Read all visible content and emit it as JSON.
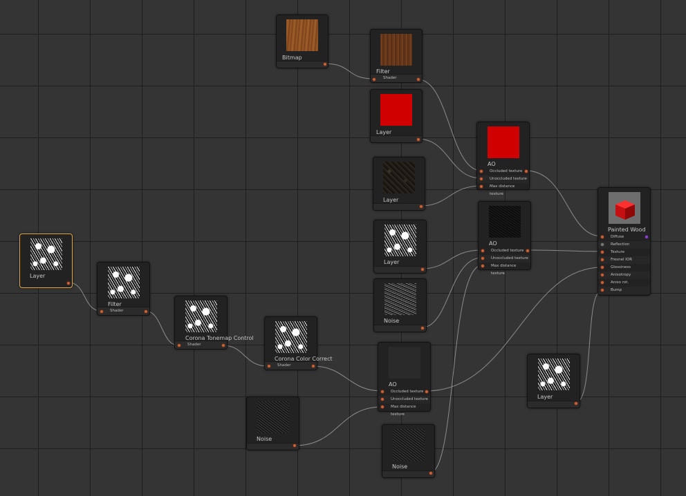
{
  "nodes": {
    "bitmap": {
      "title": "Bitmap"
    },
    "filter_top": {
      "title": "Filter",
      "footer": "Shader"
    },
    "layer_red": {
      "title": "Layer"
    },
    "ao_top": {
      "title": "AO",
      "rows": [
        "Occluded texture",
        "Unoccluded texture",
        "Max distance texture"
      ]
    },
    "layer_dark": {
      "title": "Layer"
    },
    "layer_mid": {
      "title": "Layer"
    },
    "ao_mid": {
      "title": "AO",
      "rows": [
        "Occluded texture",
        "Unoccluded texture",
        "Max distance texture"
      ]
    },
    "noise_mid": {
      "title": "Noise"
    },
    "painted_wood": {
      "title": "Painted Wood",
      "rows": [
        "Diffuse",
        "Reflection",
        "Texture",
        "Fresnel IOR",
        "Glossiness",
        "Anisotropy",
        "Aniso rot.",
        "Bump"
      ]
    },
    "layer_left": {
      "title": "Layer"
    },
    "filter_left": {
      "title": "Filter",
      "footer": "Shader"
    },
    "tonemap": {
      "title": "Corona Tonemap Control",
      "footer": "Shader"
    },
    "color_correct": {
      "title": "Corona Color Correct",
      "footer": "Shader"
    },
    "ao_bottom": {
      "title": "AO",
      "rows": [
        "Occluded texture",
        "Unoccluded texture",
        "Max distance texture"
      ]
    },
    "noise_left": {
      "title": "Noise"
    },
    "noise_bottom": {
      "title": "Noise"
    },
    "layer_right": {
      "title": "Layer"
    }
  },
  "colors": {
    "background": "#343434",
    "grid_line": "#1e1e1e",
    "node_body": "#222222",
    "port": "#c4633c",
    "wire": "#8a8a8a",
    "selected_outline": "#e0a84a"
  }
}
